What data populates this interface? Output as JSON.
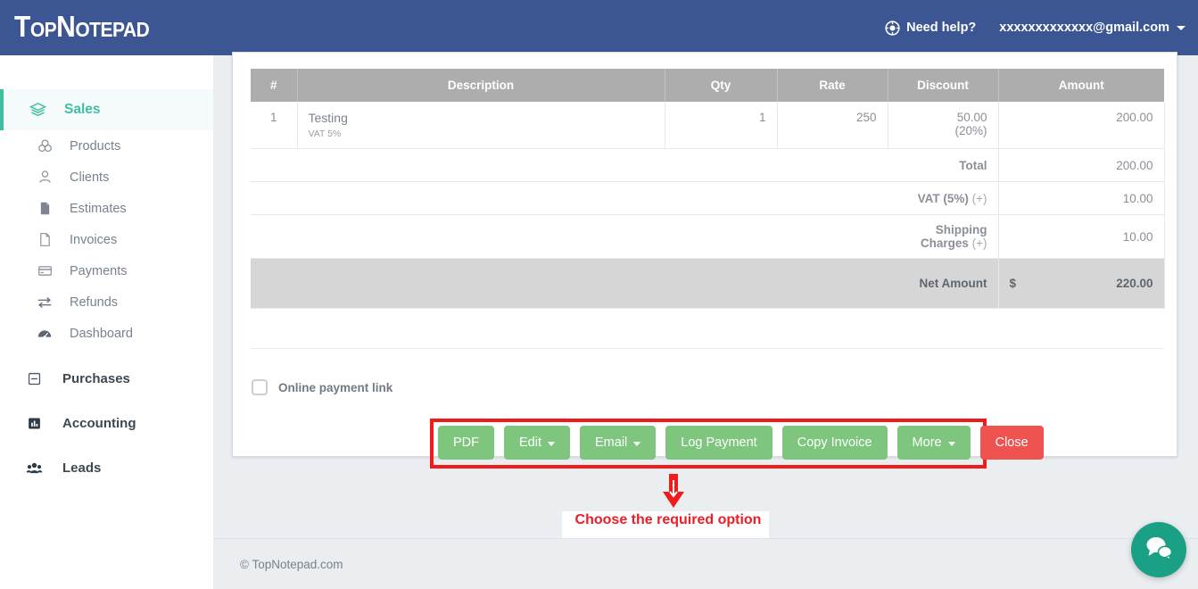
{
  "header": {
    "logo": "TopNotepad",
    "help_label": "Need help?",
    "help_icon": "life-ring-icon",
    "user_email": "xxxxxxxxxxxxx@gmail.com",
    "caret_icon": "caret-down-icon"
  },
  "sidebar": {
    "active_section": {
      "label": "Sales",
      "icon": "layers-icon"
    },
    "subitems": [
      {
        "label": "Products",
        "icon": "cubes-icon"
      },
      {
        "label": "Clients",
        "icon": "user-icon"
      },
      {
        "label": "Estimates",
        "icon": "file-filled-icon"
      },
      {
        "label": "Invoices",
        "icon": "file-outline-icon"
      },
      {
        "label": "Payments",
        "icon": "credit-card-icon"
      },
      {
        "label": "Refunds",
        "icon": "exchange-arrows-icon"
      },
      {
        "label": "Dashboard",
        "icon": "dashboard-gauge-icon"
      }
    ],
    "sections": [
      {
        "label": "Purchases",
        "icon": "minus-square-icon"
      },
      {
        "label": "Accounting",
        "icon": "bar-chart-icon"
      },
      {
        "label": "Leads",
        "icon": "users-icon"
      }
    ]
  },
  "invoice": {
    "columns": {
      "num": "#",
      "description": "Description",
      "qty": "Qty",
      "rate": "Rate",
      "discount": "Discount",
      "amount": "Amount"
    },
    "rows": [
      {
        "num": "1",
        "description": "Testing",
        "description_sub": "VAT 5%",
        "qty": "1",
        "rate": "250",
        "discount": "50.00",
        "discount_pct": "(20%)",
        "amount": "200.00"
      }
    ],
    "summary": [
      {
        "label": "Total",
        "plus": "",
        "value": "200.00"
      },
      {
        "label": "VAT (5%)",
        "plus": "(+)",
        "value": "10.00"
      },
      {
        "label": "Shipping Charges",
        "plus": "(+)",
        "value": "10.00"
      }
    ],
    "net": {
      "label": "Net Amount",
      "currency": "$",
      "value": "220.00"
    },
    "online_payment_label": "Online payment link"
  },
  "actions": {
    "buttons": [
      {
        "label": "PDF",
        "caret": false,
        "style": "green"
      },
      {
        "label": "Edit",
        "caret": true,
        "style": "green"
      },
      {
        "label": "Email",
        "caret": true,
        "style": "green"
      },
      {
        "label": "Log Payment",
        "caret": false,
        "style": "green"
      },
      {
        "label": "Copy Invoice",
        "caret": false,
        "style": "green"
      },
      {
        "label": "More",
        "caret": true,
        "style": "green"
      },
      {
        "label": "Close",
        "caret": false,
        "style": "red"
      }
    ]
  },
  "annotation": {
    "text": "Choose the required option",
    "arrow_icon": "down-arrow-annotation",
    "color": "#ee1c25"
  },
  "footer": {
    "copyright": "© TopNotepad.com"
  },
  "chat": {
    "icon": "chat-bubbles-icon"
  },
  "colors": {
    "header_blue": "#3b5693",
    "accent_green": "#3fbfa0",
    "button_green": "#7ec67e",
    "button_red": "#ef5350",
    "annotation_red": "#f01b1b",
    "page_bg": "#eaeef1",
    "table_header_grey": "#adadad",
    "net_row_grey": "#d6d6d6",
    "chat_teal": "#1aa085"
  }
}
